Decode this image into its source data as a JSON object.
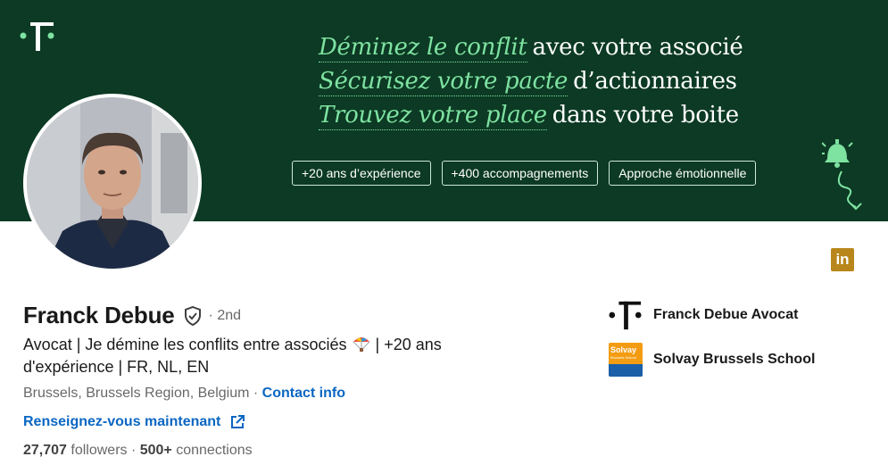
{
  "banner": {
    "taglines": [
      {
        "emphasis": "Déminez le conflit",
        "rest": "avec votre associé"
      },
      {
        "emphasis": "Sécurisez votre pacte",
        "rest": "d’actionnaires"
      },
      {
        "emphasis": "Trouvez votre place",
        "rest": "dans votre boite"
      }
    ],
    "pills": [
      "+20 ans d’expérience",
      "+400 accompagnements",
      "Approche émotionnelle"
    ],
    "colors": {
      "background": "#0c3a24",
      "accent": "#7ee2a1"
    }
  },
  "profile": {
    "name": "Franck Debue",
    "degree": "· 2nd",
    "headline_part1": "Avocat | Je démine les conflits entre associés",
    "headline_part2": "| +20 ans d'expérience | FR, NL, EN",
    "location": "Brussels, Brussels Region, Belgium",
    "location_separator": " · ",
    "contact_info": "Contact info",
    "learn_more": "Renseignez-vous maintenant",
    "followers_count": "27,707",
    "followers_label": " followers",
    "connections_separator": "  · ",
    "connections_count": "500+",
    "connections_label": " connections"
  },
  "sidebar": {
    "items": [
      {
        "name": "Franck Debue Avocat",
        "icon": "company-logo-icon"
      },
      {
        "name": "Solvay Brussels School",
        "icon": "school-logo-icon",
        "logo_text": "Solvay",
        "logo_subtext": "Brussels School"
      }
    ]
  },
  "icons": {
    "linkedin": "in",
    "verified": "shield-check-icon",
    "external": "external-link-icon"
  },
  "colors": {
    "link": "#0a66c2",
    "linkedin_badge": "#b8861b"
  }
}
